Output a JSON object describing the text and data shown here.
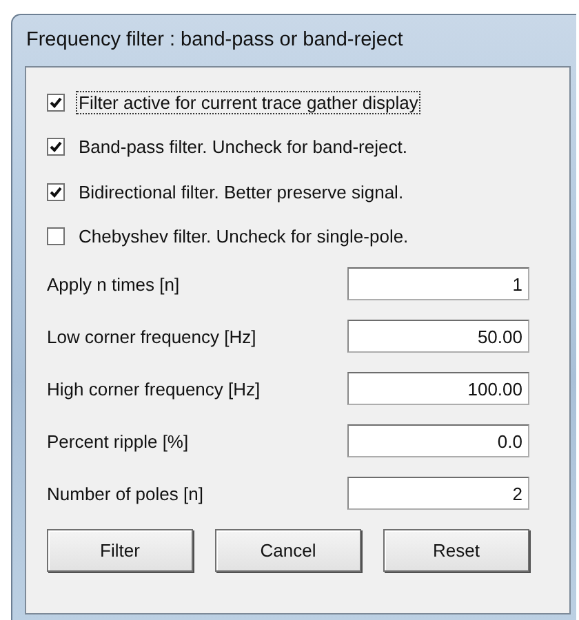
{
  "window": {
    "title": "Frequency filter : band-pass or band-reject"
  },
  "checkboxes": [
    {
      "label": "Filter active for current trace gather display",
      "checked": true,
      "focused": true
    },
    {
      "label": "Band-pass filter. Uncheck for band-reject.",
      "checked": true,
      "focused": false
    },
    {
      "label": "Bidirectional filter. Better preserve signal.",
      "checked": true,
      "focused": false
    },
    {
      "label": "Chebyshev filter. Uncheck for single-pole.",
      "checked": false,
      "focused": false
    }
  ],
  "fields": [
    {
      "label": "Apply n times [n]",
      "value": "1"
    },
    {
      "label": "Low corner frequency [Hz]",
      "value": "50.00"
    },
    {
      "label": "High corner frequency [Hz]",
      "value": "100.00"
    },
    {
      "label": "Percent ripple [%]",
      "value": "0.0"
    },
    {
      "label": "Number of poles [n]",
      "value": "2"
    }
  ],
  "buttons": [
    "Filter",
    "Cancel",
    "Reset"
  ]
}
